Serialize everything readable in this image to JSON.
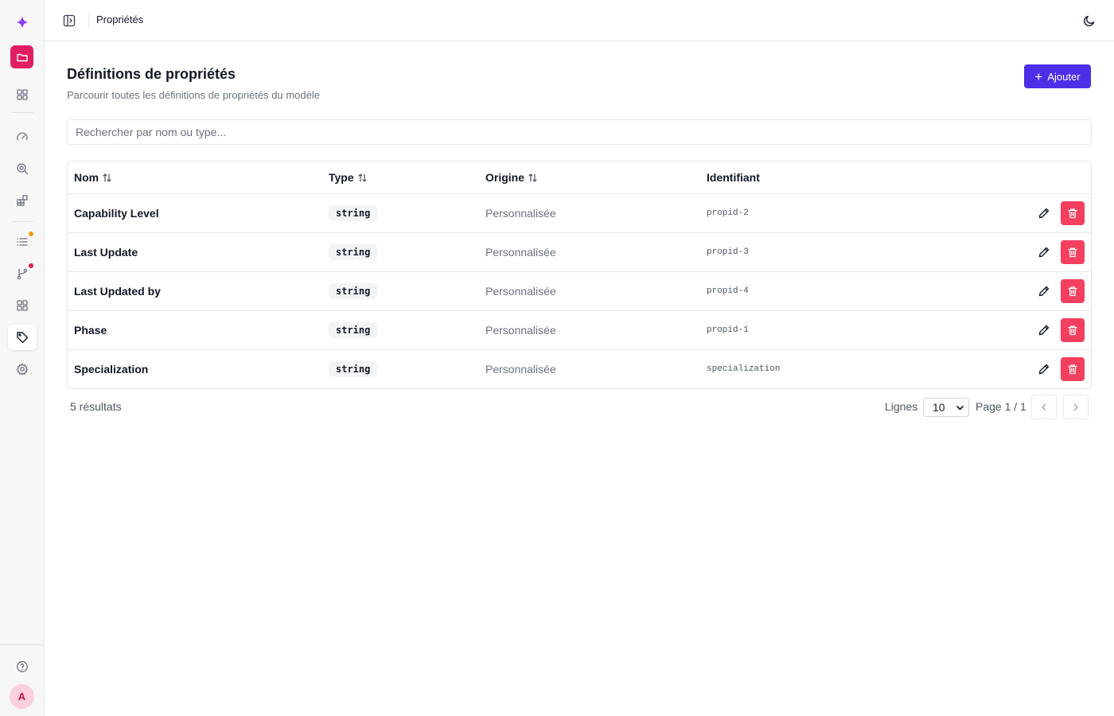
{
  "topbar": {
    "title": "Propriétés"
  },
  "page": {
    "title": "Définitions de propriétés",
    "subtitle": "Parcourir toutes les définitions de propriétés du modèle",
    "add_label": "Ajouter"
  },
  "search": {
    "placeholder": "Rechercher par nom ou type...",
    "value": ""
  },
  "table": {
    "headers": {
      "nom": "Nom",
      "type": "Type",
      "origine": "Origine",
      "identifiant": "Identifiant"
    },
    "rows": [
      {
        "nom": "Capability Level",
        "type": "string",
        "origine": "Personnalisée",
        "identifiant": "propid-2"
      },
      {
        "nom": "Last Update",
        "type": "string",
        "origine": "Personnalisée",
        "identifiant": "propid-3"
      },
      {
        "nom": "Last Updated by",
        "type": "string",
        "origine": "Personnalisée",
        "identifiant": "propid-4"
      },
      {
        "nom": "Phase",
        "type": "string",
        "origine": "Personnalisée",
        "identifiant": "propid-1"
      },
      {
        "nom": "Specialization",
        "type": "string",
        "origine": "Personnalisée",
        "identifiant": "specialization"
      }
    ]
  },
  "footer": {
    "results": "5 résultats",
    "rows_label": "Lignes",
    "rows_value": "10",
    "page_label": "Page 1 / 1"
  },
  "sidebar": {
    "avatar_initial": "A"
  },
  "colors": {
    "accent": "#4f2ee8",
    "brand_red": "#e11d63",
    "delete_red": "#f43f5e",
    "badge_orange": "#f59e0b",
    "badge_red": "#e11d48",
    "logo_purple": "#7c3aed"
  }
}
